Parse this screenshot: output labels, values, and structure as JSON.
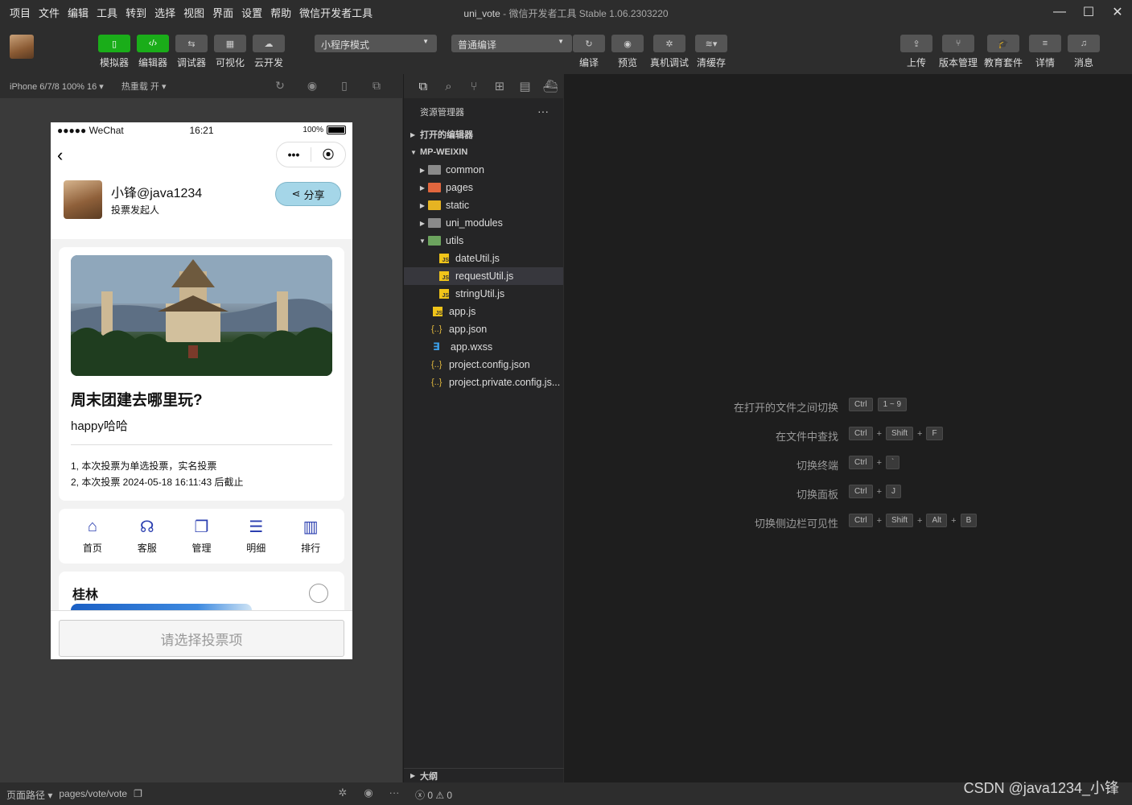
{
  "menu": [
    "项目",
    "文件",
    "编辑",
    "工具",
    "转到",
    "选择",
    "视图",
    "界面",
    "设置",
    "帮助",
    "微信开发者工具"
  ],
  "window": {
    "project": "uni_vote",
    "separator": " - ",
    "app_title": "微信开发者工具 Stable 1.06.2303220"
  },
  "window_controls": {
    "minimize": "—",
    "maximize": "☐",
    "close": "✕"
  },
  "toolbar": {
    "left_buttons": [
      {
        "label": "模拟器",
        "icon": "▯"
      },
      {
        "label": "编辑器",
        "icon": "‹/›"
      },
      {
        "label": "调试器",
        "icon": "⇆"
      },
      {
        "label": "可视化",
        "icon": "▦"
      },
      {
        "label": "云开发",
        "icon": "☁"
      }
    ],
    "mode_select": "小程序模式",
    "compile_select": "普通编译",
    "mid_buttons": [
      {
        "label": "编译",
        "icon": "↻"
      },
      {
        "label": "预览",
        "icon": "◉"
      },
      {
        "label": "真机调试",
        "icon": "✲"
      },
      {
        "label": "清缓存",
        "icon": "≋▾"
      }
    ],
    "right_buttons": [
      {
        "label": "上传",
        "icon": "⇪"
      },
      {
        "label": "版本管理",
        "icon": "⑂"
      },
      {
        "label": "教育套件",
        "icon": "🎓"
      },
      {
        "label": "详情",
        "icon": "≡"
      },
      {
        "label": "消息",
        "icon": "♫"
      }
    ]
  },
  "simulator": {
    "device": "iPhone 6/7/8 100% 16 ▾",
    "hotreload": "热重载 开 ▾",
    "status": {
      "carrier": "●●●●● WeChat",
      "time": "16:21",
      "battery": "100%"
    },
    "navbar": {
      "back": "‹",
      "capsule_more": "•••",
      "capsule_close": "⦿"
    },
    "header": {
      "name": "小锋@java1234",
      "role": "投票发起人",
      "share": "分享",
      "share_icon": "⋖"
    },
    "vote": {
      "title": "周末团建去哪里玩?",
      "desc": "happy哈哈",
      "rules": [
        "1, 本次投票为单选投票，实名投票",
        "2, 本次投票 2024-05-18 16:11:43 后截止"
      ]
    },
    "nav": [
      {
        "label": "首页",
        "icon": "⌂"
      },
      {
        "label": "客服",
        "icon": "☊"
      },
      {
        "label": "管理",
        "icon": "❐"
      },
      {
        "label": "明细",
        "icon": "☰"
      },
      {
        "label": "排行",
        "icon": "▥"
      }
    ],
    "option": {
      "name": "桂林"
    },
    "submit": "请选择投票项"
  },
  "explorer": {
    "tabs": [
      "⧉",
      "⌕",
      "⑂",
      "⊞",
      "▤",
      "⛴"
    ],
    "title": "资源管理器",
    "more": "···",
    "open_editors": "打开的编辑器",
    "project": "MP-WEIXIN",
    "folders": [
      "common",
      "pages",
      "static",
      "uni_modules",
      "utils"
    ],
    "utils_files": [
      "dateUtil.js",
      "requestUtil.js",
      "stringUtil.js"
    ],
    "root_files": [
      "app.js",
      "app.json",
      "app.wxss",
      "project.config.json",
      "project.private.config.js..."
    ],
    "outline": "大纲"
  },
  "shortcuts": [
    {
      "desc": "在打开的文件之间切换",
      "keys": [
        "Ctrl",
        "1 ~ 9"
      ]
    },
    {
      "desc": "在文件中查找",
      "keys": [
        "Ctrl",
        "Shift",
        "F"
      ]
    },
    {
      "desc": "切换终端",
      "keys": [
        "Ctrl",
        "`"
      ]
    },
    {
      "desc": "切换面板",
      "keys": [
        "Ctrl",
        "J"
      ]
    },
    {
      "desc": "切换侧边栏可见性",
      "keys": [
        "Ctrl",
        "Shift",
        "Alt",
        "B"
      ]
    }
  ],
  "statusbar": {
    "page_path_label": "页面路径 ▾",
    "page_path": "pages/vote/vote",
    "copy_icon": "❐",
    "icons": [
      "✲",
      "◉",
      "···"
    ],
    "problems": "ⓧ 0 ⚠ 0"
  },
  "watermark": "CSDN @java1234_小锋"
}
